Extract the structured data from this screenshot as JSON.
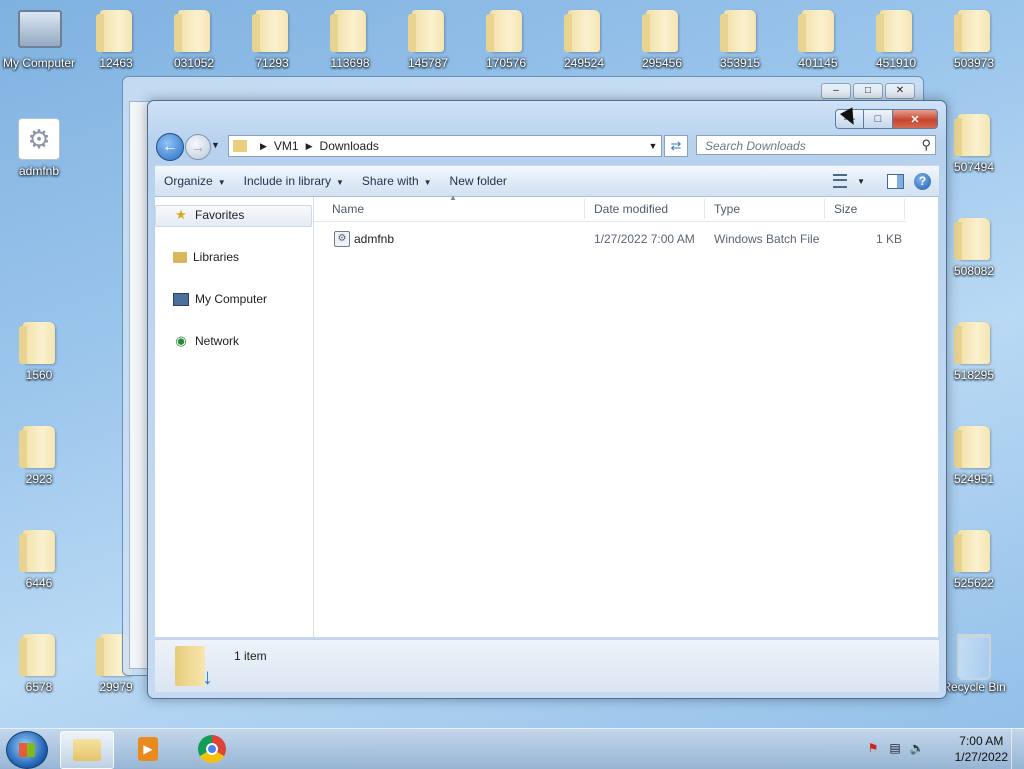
{
  "desktop": {
    "top_icons": [
      "My Computer",
      "12463",
      "031052",
      "71293",
      "113698",
      "145787",
      "170576",
      "249524",
      "295456",
      "353915",
      "401145",
      "451910",
      "503973"
    ],
    "left_icons": [
      "admfnb",
      "1560",
      "2923",
      "6446",
      "6578",
      "29979"
    ],
    "right_icons": [
      "507494",
      "508082",
      "518295",
      "524951",
      "525622"
    ],
    "recycle_bin": "Recycle Bin"
  },
  "window": {
    "address": {
      "segments": [
        "VM1",
        "Downloads"
      ]
    },
    "search_placeholder": "Search Downloads",
    "toolbar": {
      "organize": "Organize",
      "include": "Include in library",
      "share": "Share with",
      "new_folder": "New folder"
    },
    "nav": {
      "favorites": "Favorites",
      "libraries": "Libraries",
      "computer": "My Computer",
      "network": "Network"
    },
    "columns": {
      "name": "Name",
      "date": "Date modified",
      "type": "Type",
      "size": "Size"
    },
    "files": [
      {
        "name": "admfnb",
        "date": "1/27/2022 7:00 AM",
        "type": "Windows Batch File",
        "size": "1 KB"
      }
    ],
    "status": "1 item"
  },
  "taskbar": {
    "time": "7:00 AM",
    "date": "1/27/2022"
  }
}
